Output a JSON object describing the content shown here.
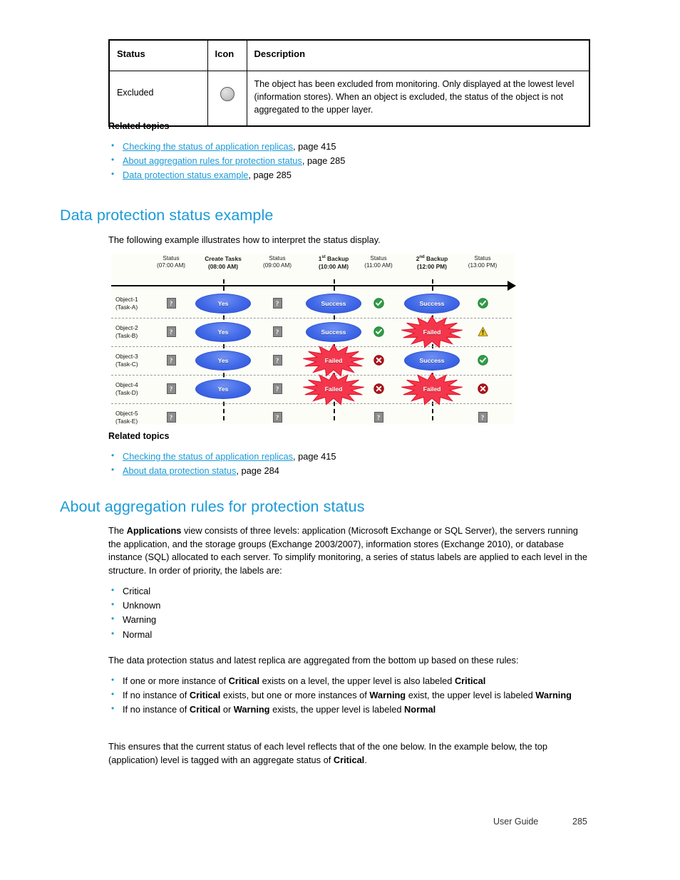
{
  "status_table": {
    "headers": [
      "Status",
      "Icon",
      "Description"
    ],
    "rows": [
      {
        "status": "Excluded",
        "icon": "gray-circle-icon",
        "description": "The object has been excluded from monitoring. Only displayed at the lowest level (information stores). When an object is excluded, the status of the object is not aggregated to the upper layer."
      }
    ]
  },
  "related_topics_1": {
    "heading": "Related topics",
    "items": [
      {
        "link": "Checking the status of application replicas",
        "suffix": ", page 415"
      },
      {
        "link": "About aggregation rules for protection status",
        "suffix": ", page 285"
      },
      {
        "link": "Data protection status example",
        "suffix": ", page 285"
      }
    ]
  },
  "section_example": {
    "heading": "Data protection status example",
    "intro": "The following example illustrates how to interpret the status display."
  },
  "diagram": {
    "columns": [
      {
        "title": "Status",
        "time": "(07:00 AM)",
        "bold": false
      },
      {
        "title": "Create Tasks",
        "time": "(08:00 AM)",
        "bold": true
      },
      {
        "title": "Status",
        "time": "(09:00 AM)",
        "bold": false
      },
      {
        "title": "1st Backup",
        "time": "(10:00 AM)",
        "bold": true,
        "sup": "st",
        "base": "1"
      },
      {
        "title": "Status",
        "time": "(11:00 AM)",
        "bold": false
      },
      {
        "title": "2nd Backup",
        "time": "(12:00 PM)",
        "bold": true,
        "sup": "nd",
        "base": "2"
      },
      {
        "title": "Status",
        "time": "(13:00 PM)",
        "bold": false
      }
    ],
    "rows": [
      {
        "object": "Object-1",
        "task": "(Task-A)",
        "cells": [
          {
            "type": "unknown",
            "label": "?"
          },
          {
            "type": "ellipse",
            "label": "Yes"
          },
          {
            "type": "unknown",
            "label": "?"
          },
          {
            "type": "ellipse",
            "label": "Success"
          },
          {
            "type": "ok-icon",
            "label": ""
          },
          {
            "type": "ellipse",
            "label": "Success"
          },
          {
            "type": "ok-icon",
            "label": ""
          }
        ]
      },
      {
        "object": "Object-2",
        "task": "(Task-B)",
        "cells": [
          {
            "type": "unknown",
            "label": "?"
          },
          {
            "type": "ellipse",
            "label": "Yes"
          },
          {
            "type": "unknown",
            "label": "?"
          },
          {
            "type": "ellipse",
            "label": "Success"
          },
          {
            "type": "ok-icon",
            "label": ""
          },
          {
            "type": "burst",
            "label": "Failed"
          },
          {
            "type": "warning-icon",
            "label": ""
          }
        ]
      },
      {
        "object": "Object-3",
        "task": "(Task-C)",
        "cells": [
          {
            "type": "unknown",
            "label": "?"
          },
          {
            "type": "ellipse",
            "label": "Yes"
          },
          {
            "type": "unknown",
            "label": "?"
          },
          {
            "type": "burst",
            "label": "Failed"
          },
          {
            "type": "error-icon",
            "label": ""
          },
          {
            "type": "ellipse",
            "label": "Success"
          },
          {
            "type": "ok-icon",
            "label": ""
          }
        ]
      },
      {
        "object": "Object-4",
        "task": "(Task-D)",
        "cells": [
          {
            "type": "unknown",
            "label": "?"
          },
          {
            "type": "ellipse",
            "label": "Yes"
          },
          {
            "type": "unknown",
            "label": "?"
          },
          {
            "type": "burst",
            "label": "Failed"
          },
          {
            "type": "error-icon",
            "label": ""
          },
          {
            "type": "burst",
            "label": "Failed"
          },
          {
            "type": "error-icon",
            "label": ""
          }
        ]
      },
      {
        "object": "Object-5",
        "task": "(Task-E)",
        "cells": [
          {
            "type": "unknown",
            "label": "?"
          },
          {
            "type": "empty",
            "label": ""
          },
          {
            "type": "unknown",
            "label": "?"
          },
          {
            "type": "empty",
            "label": ""
          },
          {
            "type": "unknown",
            "label": "?"
          },
          {
            "type": "empty",
            "label": ""
          },
          {
            "type": "unknown",
            "label": "?"
          }
        ]
      }
    ]
  },
  "related_topics_2": {
    "heading": "Related topics",
    "items": [
      {
        "link": "Checking the status of application replicas",
        "suffix": ", page 415"
      },
      {
        "link": "About data protection status",
        "suffix": ", page 284"
      }
    ]
  },
  "section_rules": {
    "heading": "About aggregation rules for protection status",
    "para1_a": "The ",
    "para1_b": "Applications",
    "para1_c": " view consists of three levels: application (Microsoft Exchange or SQL Server), the servers running the application, and the storage groups (Exchange 2003/2007), information stores (Exchange 2010), or database instance (SQL) allocated to each server. To simplify monitoring, a series of status labels are applied to each level in the structure. In order of priority, the labels are:",
    "labels": [
      "Critical",
      "Unknown",
      "Warning",
      "Normal"
    ],
    "para2": "The data protection status and latest replica are aggregated from the bottom up based on these rules:",
    "rules": [
      {
        "p1": "If one or more instance of ",
        "b1": "Critical",
        "p2": " exists on a level, the upper level is also labeled ",
        "b2": "Critical",
        "p3": ""
      },
      {
        "p1": "If no instance of ",
        "b1": "Critical",
        "p2": " exists, but one or more instances of ",
        "b2": "Warning",
        "p3": " exist, the upper level is labeled ",
        "b3": "Warning"
      },
      {
        "p1": "If no instance of ",
        "b1": "Critical",
        "p2": " or ",
        "b2": "Warning",
        "p3": " exists, the upper level is labeled ",
        "b3": "Normal"
      }
    ],
    "para3_a": "This ensures that the current status of each level reflects that of the one below. In the example below, the top (application) level is tagged with an aggregate status of ",
    "para3_b": "Critical",
    "para3_c": "."
  },
  "footer": {
    "label": "User Guide",
    "page": "285"
  },
  "colors": {
    "accent": "#1b9ad6",
    "ok": "#2e9e46",
    "error": "#b5121b",
    "warning": "#e8c42a",
    "node": "#4169e8",
    "burst": "#f4364c"
  }
}
